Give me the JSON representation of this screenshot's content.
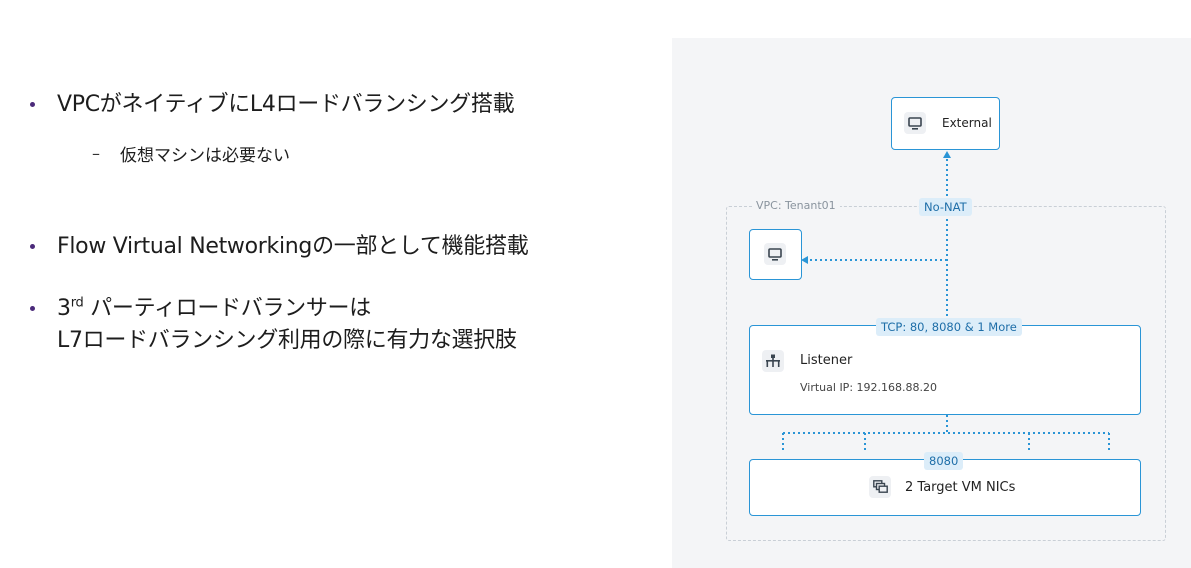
{
  "bullets": {
    "item1": "VPCがネイティブにL4ロードバランシング搭載",
    "item1_sub": "仮想マシンは必要ない",
    "item1_sub_dash": "–",
    "item2": "Flow Virtual Networkingの一部として機能搭載",
    "item3_num": "3",
    "item3_sup": "rd",
    "item3_line1_rest": " パーティロードバランサーは",
    "item3_line2": "L7ロードバランシング利用の際に有力な選択肢"
  },
  "diagram": {
    "external_label": "External",
    "vpc_label": "VPC: Tenant01",
    "nonat_badge": "No-NAT",
    "listener_ports_badge": "TCP: 80, 8080 & 1 More",
    "listener_title": "Listener",
    "listener_vip": "Virtual IP: 192.168.88.20",
    "target_port_badge": "8080",
    "target_label": "2 Target VM NICs",
    "colors": {
      "accent": "#2a95d6",
      "badge_bg": "#dcedf9",
      "badge_text": "#1e6ea8",
      "panel_bg": "#f4f5f7",
      "bullet": "#4b2a7a"
    }
  }
}
